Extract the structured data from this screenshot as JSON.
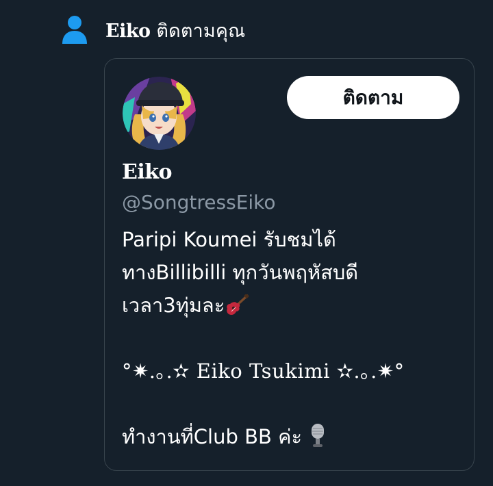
{
  "notification": {
    "name": "Eiko",
    "action_text": " ติดตามคุณ",
    "icon": "person-icon",
    "icon_color": "#1d9bf0"
  },
  "profile_card": {
    "follow_button_label": "ติดตาม",
    "display_name": "Eiko",
    "handle": "@SongtressEiko",
    "bio": {
      "line1": "Paripi Koumei รับชมได้",
      "line2": "ทางBillibilli ทุกวันพฤหัสบดี",
      "line3": "เวลา3ทุ่มละ",
      "line3_emoji": "guitar-icon",
      "line4": "°✷.｡.✫ Eiko Tsukimi ✫.｡.✷°",
      "line5": "ทำงานที่Club BB ค่ะ",
      "line5_emoji": "microphone-icon"
    }
  },
  "colors": {
    "background": "#15202b",
    "card_border": "#38444d",
    "secondary_text": "#8b98a5",
    "button_bg": "#ffffff",
    "button_text": "#0f1419"
  }
}
